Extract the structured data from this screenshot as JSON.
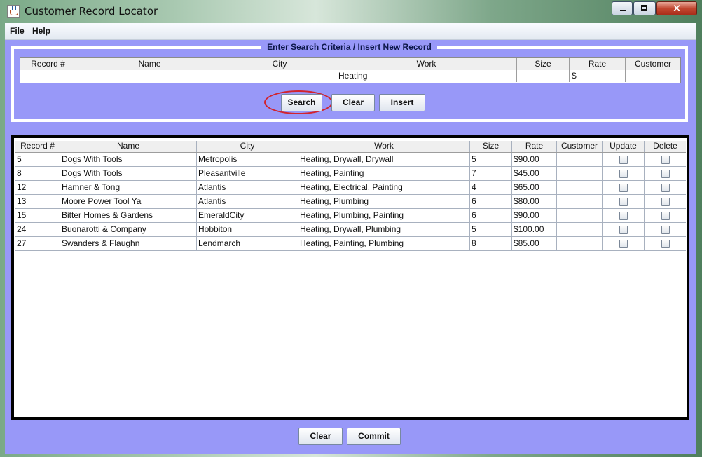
{
  "window": {
    "title": "Customer Record Locator",
    "close_glyph": "✕"
  },
  "menu": {
    "file": "File",
    "help": "Help"
  },
  "criteria": {
    "title": "Enter Search Criteria / Insert New Record",
    "columns": [
      "Record #",
      "Name",
      "City",
      "Work",
      "Size",
      "Rate",
      "Customer"
    ],
    "values": [
      "",
      "",
      "",
      "Heating",
      "",
      "$",
      ""
    ]
  },
  "buttons": {
    "search": "Search",
    "clear": "Clear",
    "insert": "Insert",
    "bottom_clear": "Clear",
    "commit": "Commit"
  },
  "results": {
    "columns": [
      "Record #",
      "Name",
      "City",
      "Work",
      "Size",
      "Rate",
      "Customer",
      "Update",
      "Delete"
    ],
    "rows": [
      {
        "record": "5",
        "name": "Dogs With Tools",
        "city": "Metropolis",
        "work": "Heating, Drywall, Drywall",
        "size": "5",
        "rate": "$90.00",
        "customer": "",
        "update": false,
        "delete": false
      },
      {
        "record": "8",
        "name": "Dogs With Tools",
        "city": "Pleasantville",
        "work": "Heating, Painting",
        "size": "7",
        "rate": "$45.00",
        "customer": "",
        "update": false,
        "delete": false
      },
      {
        "record": "12",
        "name": "Hamner & Tong",
        "city": "Atlantis",
        "work": "Heating, Electrical, Painting",
        "size": "4",
        "rate": "$65.00",
        "customer": "",
        "update": false,
        "delete": false
      },
      {
        "record": "13",
        "name": "Moore Power Tool Ya",
        "city": "Atlantis",
        "work": "Heating, Plumbing",
        "size": "6",
        "rate": "$80.00",
        "customer": "",
        "update": false,
        "delete": false
      },
      {
        "record": "15",
        "name": "Bitter Homes & Gardens",
        "city": "EmeraldCity",
        "work": "Heating, Plumbing, Painting",
        "size": "6",
        "rate": "$90.00",
        "customer": "",
        "update": false,
        "delete": false
      },
      {
        "record": "24",
        "name": "Buonarotti & Company",
        "city": "Hobbiton",
        "work": "Heating, Drywall, Plumbing",
        "size": "5",
        "rate": "$100.00",
        "customer": "",
        "update": false,
        "delete": false
      },
      {
        "record": "27",
        "name": "Swanders & Flaughn",
        "city": "Lendmarch",
        "work": "Heating, Painting, Plumbing",
        "size": "8",
        "rate": "$85.00",
        "customer": "",
        "update": false,
        "delete": false
      }
    ]
  }
}
